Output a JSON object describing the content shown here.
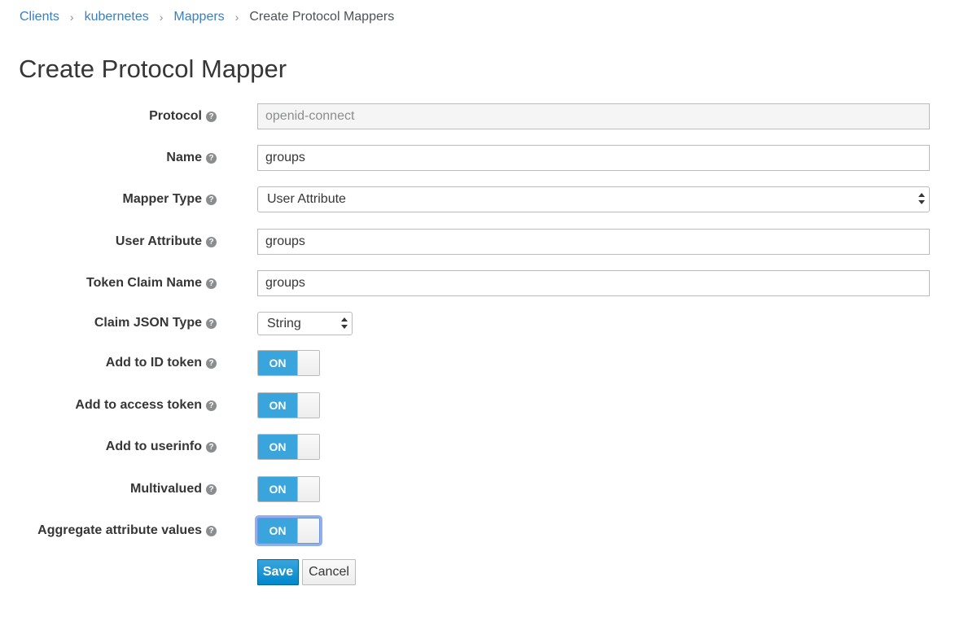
{
  "breadcrumb": {
    "items": [
      "Clients",
      "kubernetes",
      "Mappers"
    ],
    "current": "Create Protocol Mappers",
    "separator": "›"
  },
  "page_title": "Create Protocol Mapper",
  "form": {
    "protocol": {
      "label": "Protocol",
      "value": "openid-connect"
    },
    "name": {
      "label": "Name",
      "value": "groups"
    },
    "mapper_type": {
      "label": "Mapper Type",
      "value": "User Attribute"
    },
    "user_attribute": {
      "label": "User Attribute",
      "value": "groups"
    },
    "token_claim_name": {
      "label": "Token Claim Name",
      "value": "groups"
    },
    "claim_json_type": {
      "label": "Claim JSON Type",
      "value": "String"
    },
    "add_to_id_token": {
      "label": "Add to ID token",
      "state": "ON"
    },
    "add_to_access_token": {
      "label": "Add to access token",
      "state": "ON"
    },
    "add_to_userinfo": {
      "label": "Add to userinfo",
      "state": "ON"
    },
    "multivalued": {
      "label": "Multivalued",
      "state": "ON"
    },
    "aggregate_attribute_values": {
      "label": "Aggregate attribute values",
      "state": "ON"
    }
  },
  "help_icon": {
    "icon": "question-circle-icon",
    "glyph": "?"
  },
  "buttons": {
    "save": "Save",
    "cancel": "Cancel"
  },
  "colors": {
    "link": "#3a7fc2",
    "toggle_on": "#39a5dc",
    "primary": "#0088ce",
    "focus_ring": "#8fb0ec"
  }
}
